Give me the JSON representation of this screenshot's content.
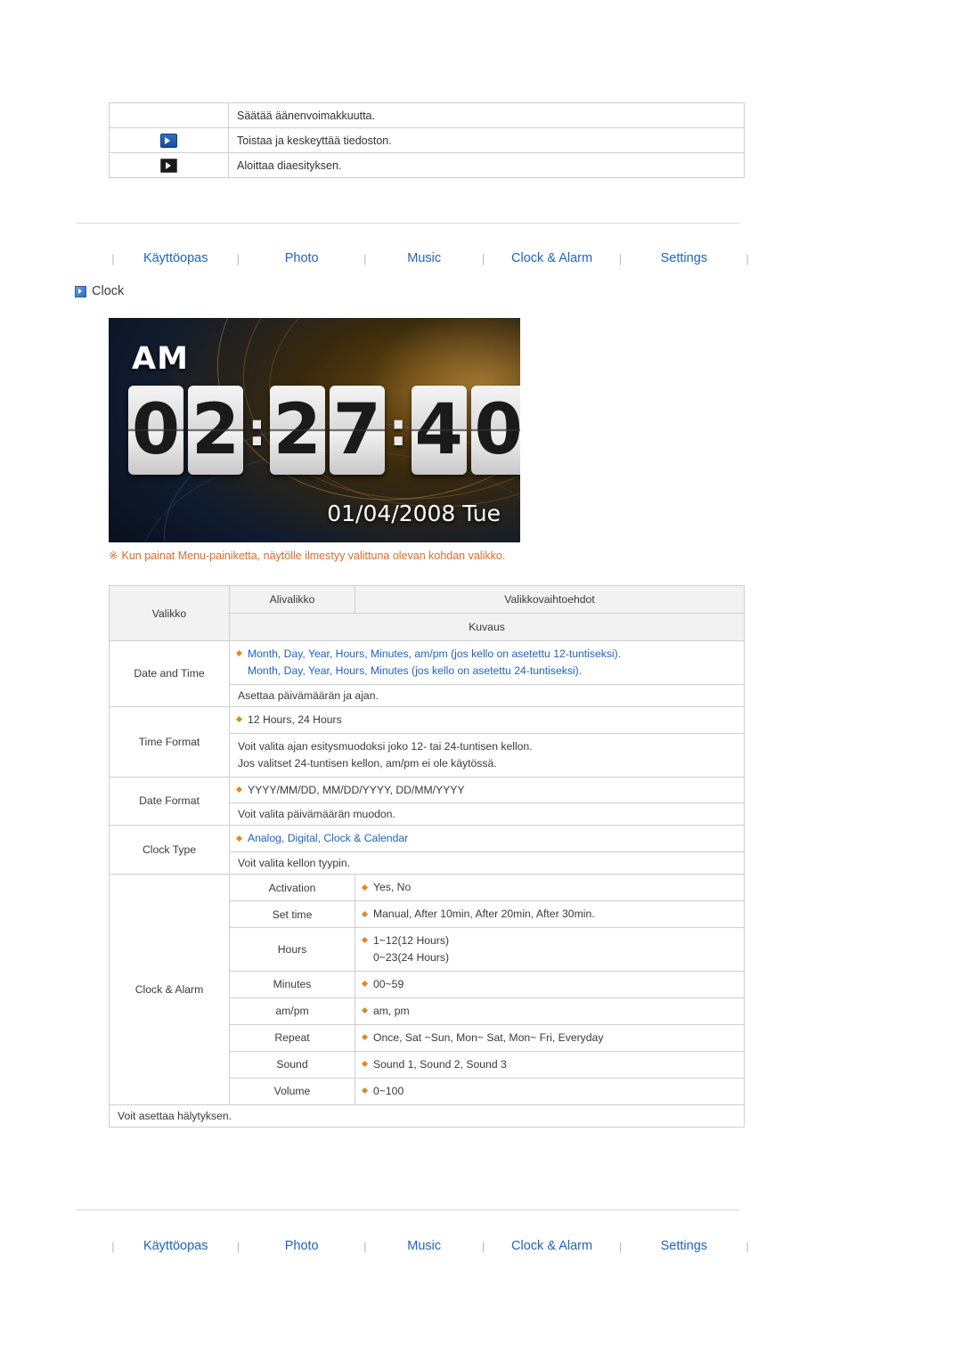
{
  "top_table": {
    "rows": [
      {
        "icon": "",
        "desc": "Säätää äänenvoimakkuutta."
      },
      {
        "icon": "play-icon",
        "desc": "Toistaa ja keskeyttää tiedoston."
      },
      {
        "icon": "slideshow-icon",
        "desc": "Aloittaa diaesityksen."
      }
    ]
  },
  "nav": {
    "items": [
      {
        "label": "Käyttöopas"
      },
      {
        "label": "Photo"
      },
      {
        "label": "Music"
      },
      {
        "label": "Clock & Alarm"
      },
      {
        "label": "Settings"
      }
    ],
    "separator": "|"
  },
  "section": {
    "title": "Clock"
  },
  "clock_screen": {
    "meridiem": "AM",
    "digits": [
      "0",
      "2",
      "2",
      "7",
      "4",
      "0"
    ],
    "colon": ":",
    "date": "01/04/2008 Tue"
  },
  "note": {
    "mark": "※",
    "text": "Kun painat Menu-painiketta, näytölle ilmestyy valittuna olevan kohdan valikko."
  },
  "main_table": {
    "headers": {
      "menu": "Valikko",
      "submenu": "Alivalikko",
      "options": "Valikkovaihtoehdot",
      "description": "Kuvaus"
    },
    "sections": [
      {
        "menu": "Date and Time",
        "option_lines": [
          "Month, Day, Year, Hours, Minutes, am/pm (jos kello on asetettu 12-tuntiseksi).",
          "Month, Day, Year, Hours, Minutes (jos kello on asetettu 24-tuntiseksi)."
        ],
        "description": "Asettaa päivämäärän ja ajan."
      },
      {
        "menu": "Time Format",
        "option_lines": [
          "12 Hours, 24 Hours"
        ],
        "description_lines": [
          "Voit valita ajan esitysmuodoksi joko 12- tai 24-tuntisen kellon.",
          "Jos valitset 24-tuntisen kellon, am/pm ei ole käytössä."
        ]
      },
      {
        "menu": "Date Format",
        "option_lines": [
          "YYYY/MM/DD, MM/DD/YYYY, DD/MM/YYYY"
        ],
        "description": "Voit valita päivämäärän muodon."
      },
      {
        "menu": "Clock Type",
        "option_lines": [
          "Analog, Digital, Clock & Calendar"
        ],
        "description": "Voit valita kellon tyypin."
      }
    ],
    "alarm": {
      "menu": "Clock & Alarm",
      "rows": [
        {
          "submenu": "Activation",
          "options": [
            "Yes, No"
          ]
        },
        {
          "submenu": "Set time",
          "options": [
            "Manual, After 10min, After 20min, After 30min."
          ]
        },
        {
          "submenu": "Hours",
          "options": [
            "1~12(12 Hours)",
            "0~23(24 Hours)"
          ]
        },
        {
          "submenu": "Minutes",
          "options": [
            "00~59"
          ]
        },
        {
          "submenu": "am/pm",
          "options": [
            "am, pm"
          ]
        },
        {
          "submenu": "Repeat",
          "options": [
            "Once, Sat ~Sun, Mon~ Sat, Mon~ Fri, Everyday"
          ]
        },
        {
          "submenu": "Sound",
          "options": [
            "Sound 1, Sound 2, Sound 3"
          ]
        },
        {
          "submenu": "Volume",
          "options": [
            "0~100"
          ]
        }
      ],
      "description": "Voit asettaa hälytyksen."
    }
  }
}
